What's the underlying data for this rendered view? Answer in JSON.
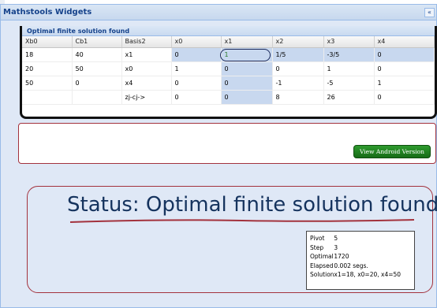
{
  "widget": {
    "title": "Mathstools Widgets",
    "collapse_icon": "double-chevron-up-icon",
    "grid_title": "Optimal finite solution found"
  },
  "table": {
    "columns": [
      "Xb0",
      "Cb1",
      "Basis2",
      "x0",
      "x1",
      "x2",
      "x3",
      "x4"
    ],
    "rows": [
      [
        "18",
        "40",
        "x1",
        "0",
        "1",
        "1/5",
        "-3/5",
        "0"
      ],
      [
        "20",
        "50",
        "x0",
        "1",
        "0",
        "0",
        "1",
        "0"
      ],
      [
        "50",
        "0",
        "x4",
        "0",
        "0",
        "-1",
        "-5",
        "1"
      ],
      [
        "",
        "",
        "zj-cj->",
        "0",
        "0",
        "8",
        "26",
        "0"
      ]
    ]
  },
  "android_button": {
    "label": "View Android Version"
  },
  "status": {
    "text": "Status: Optimal finite solution found",
    "pivot_label": "Pivot",
    "pivot_value": "5",
    "step_label": "Step",
    "step_value": "3",
    "optimal_label": "Optimal",
    "optimal_value": "1720",
    "elapsed_label": "Elapsed",
    "elapsed_value": "0.002 segs.",
    "solution_label": "Solution",
    "solution_value": "x1=18, x0=20, x4=50"
  },
  "colors": {
    "panel_bg": "#dfe8f6",
    "header_text": "#15428b",
    "status_text": "#15335e",
    "annotation_red": "#a3323d",
    "android_green": "#1f7f1f"
  }
}
